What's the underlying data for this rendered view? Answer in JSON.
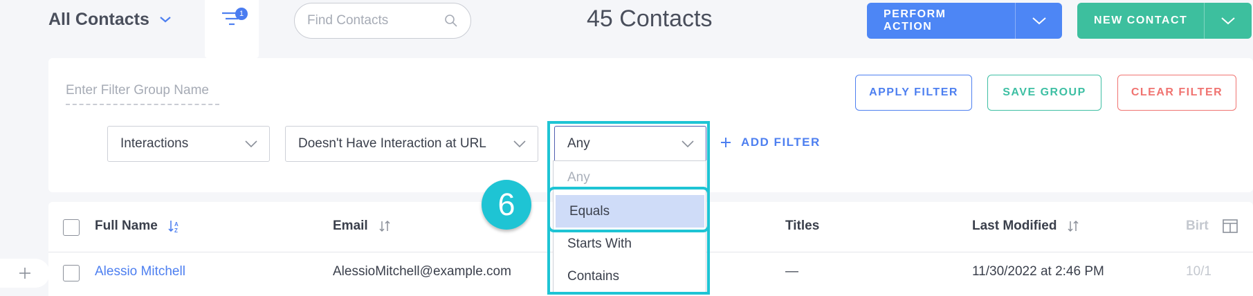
{
  "header": {
    "view_title": "All Contacts",
    "filter_badge": "1",
    "search_placeholder": "Find Contacts",
    "contact_count": "45 Contacts",
    "perform_action_label": "PERFORM ACTION",
    "new_contact_label": "NEW CONTACT"
  },
  "filter": {
    "group_name_placeholder": "Enter Filter Group Name",
    "apply_label": "APPLY FILTER",
    "save_label": "SAVE GROUP",
    "clear_label": "CLEAR FILTER",
    "category_value": "Interactions",
    "condition_value": "Doesn't Have Interaction at URL",
    "match_value": "Any",
    "add_filter_label": "ADD FILTER",
    "match_options": [
      "Any",
      "Equals",
      "Starts With",
      "Contains"
    ],
    "highlighted_option": "Equals"
  },
  "annotation": {
    "step_number": "6"
  },
  "table": {
    "columns": [
      "Full Name",
      "Email",
      "Titles",
      "Last Modified",
      "Birt"
    ],
    "rows": [
      {
        "full_name": "Alessio Mitchell",
        "email": "AlessioMitchell@example.com",
        "titles": "—",
        "last_modified": "11/30/2022 at 2:46 PM",
        "birth": "10/1"
      }
    ]
  },
  "colors": {
    "accent_blue": "#4d86f5",
    "accent_green": "#3dbf9e",
    "danger_red": "#f07370",
    "highlight_cyan": "#1ec4d4",
    "selected_option_bg": "#cfdcf8"
  }
}
